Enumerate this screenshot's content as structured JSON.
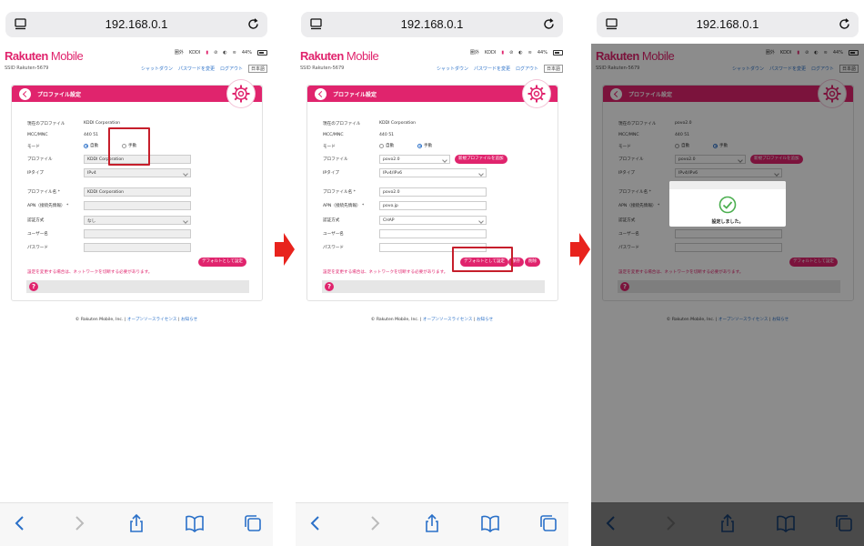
{
  "browser": {
    "url": "192.168.0.1"
  },
  "header": {
    "brand_main": "Rakuten",
    "brand_sub": "Mobile",
    "ssid": "SSID Rakuten-5679",
    "carrier_area": "圏外",
    "carrier": "KDDI",
    "battery": "44%",
    "links": {
      "shutdown": "シャットダウン",
      "change_password": "パスワードを変更",
      "logout": "ログアウト",
      "language": "日本語"
    }
  },
  "card": {
    "title": "プロファイル設定"
  },
  "labels": {
    "current_profile": "現在のプロファイル",
    "mcc_mnc": "MCC/MNC",
    "mode": "モード",
    "profile": "プロファイル",
    "ip_type": "IPタイプ",
    "profile_name": "プロファイル名 *",
    "apn": "APN（接続先情報） *",
    "auth": "認証方式",
    "username": "ユーザー名",
    "password": "パスワード",
    "mode_auto": "自動",
    "mode_manual": "手動",
    "warning": "設定を変更する場合は、ネットワークを切断する必要があります。",
    "set_default": "デフォルトとして設定",
    "save": "保存",
    "delete": "削除",
    "add_profile": "新規プロファイルを追加",
    "help": "?"
  },
  "screen1": {
    "current_profile": "KDDI Corporation",
    "mcc_mnc": "440 51",
    "mode_selected": "自動",
    "profile": "KDDI Corporation",
    "ip_type": "IPv4",
    "profile_name": "KDDI Corporation",
    "apn": "",
    "auth": "なし",
    "username": "",
    "password": ""
  },
  "screen2": {
    "current_profile": "KDDI Corporation",
    "mcc_mnc": "440 51",
    "mode_selected": "手動",
    "profile": "povo2.0",
    "ip_type": "IPv4/IPv6",
    "profile_name": "povo2.0",
    "apn": "povo.jp",
    "auth": "CHAP",
    "username": "",
    "password": ""
  },
  "screen3": {
    "current_profile": "povo2.0",
    "mcc_mnc": "440 51",
    "profile": "povo2.0",
    "ip_type": "IPv4/IPv6"
  },
  "dialog": {
    "message": "設定しました。"
  },
  "footer": {
    "copyright": "© Rakuten Mobile, Inc.",
    "oss": "オープンソースライセンス",
    "notice": "お知らせ",
    "sep": "|"
  },
  "colors": {
    "brand": "#e0246d",
    "highlight": "#c61e2b",
    "link": "#2a70c8",
    "arrow": "#e8231d",
    "check": "#4caf50"
  },
  "icons": [
    "tabs-icon",
    "reload-icon",
    "gear-icon",
    "back-icon",
    "help-icon",
    "back-arrow-icon",
    "forward-arrow-icon",
    "share-icon",
    "bookmarks-icon",
    "tabs-overview-icon",
    "checkmark-icon",
    "next-step-arrow-icon"
  ]
}
